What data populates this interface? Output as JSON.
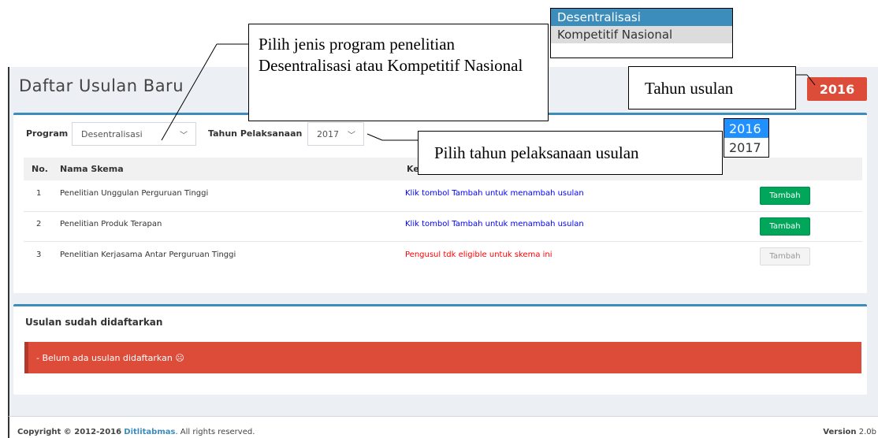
{
  "page": {
    "title": "Daftar Usulan Baru",
    "year_badge": "2016"
  },
  "filters": {
    "program_label": "Program",
    "program_value": "Desentralisasi",
    "year_label": "Tahun Pelaksanaan",
    "year_value": "2017"
  },
  "table": {
    "headers": [
      "No.",
      "Nama Skema",
      "Ke"
    ],
    "rows": [
      {
        "no": "1",
        "name": "Penelitian Unggulan Perguruan Tinggi",
        "note": "Klik tombol Tambah untuk menambah usulan",
        "note_status": "ok",
        "button": "Tambah"
      },
      {
        "no": "2",
        "name": "Penelitian Produk Terapan",
        "note": "Klik tombol Tambah untuk menambah usulan",
        "note_status": "ok",
        "button": "Tambah"
      },
      {
        "no": "3",
        "name": "Penelitian Kerjasama Antar Perguruan Tinggi",
        "note": "Pengusul tdk eligible untuk skema ini",
        "note_status": "error",
        "button": "Tambah"
      }
    ]
  },
  "registered": {
    "title": "Usulan sudah didaftarkan",
    "alert": "- Belum ada usulan didaftarkan ☹"
  },
  "footer": {
    "copyright_prefix": "Copyright © 2012-2016",
    "brand": "Ditlitabmas",
    "copyright_suffix": ". All rights reserved.",
    "version_label": "Version",
    "version_value": "2.0b"
  },
  "annotations": {
    "program_callout": "Pilih jenis program penelitian Desentralisasi atau Kompetitif Nasional",
    "year_badge_callout": "Tahun usulan",
    "year_select_callout": "Pilih tahun pelaksanaan usulan"
  },
  "program_dropdown": {
    "options": [
      "Desentralisasi",
      "Kompetitif Nasional"
    ],
    "selected_index": 0
  },
  "year_dropdown": {
    "options": [
      "2016",
      "2017"
    ],
    "selected_index": 0
  },
  "colors": {
    "primary": "#3c8dbc",
    "danger": "#dd4b39",
    "success": "#00a65a",
    "link_blue": "#0000ff",
    "error_red": "#ff0000"
  }
}
